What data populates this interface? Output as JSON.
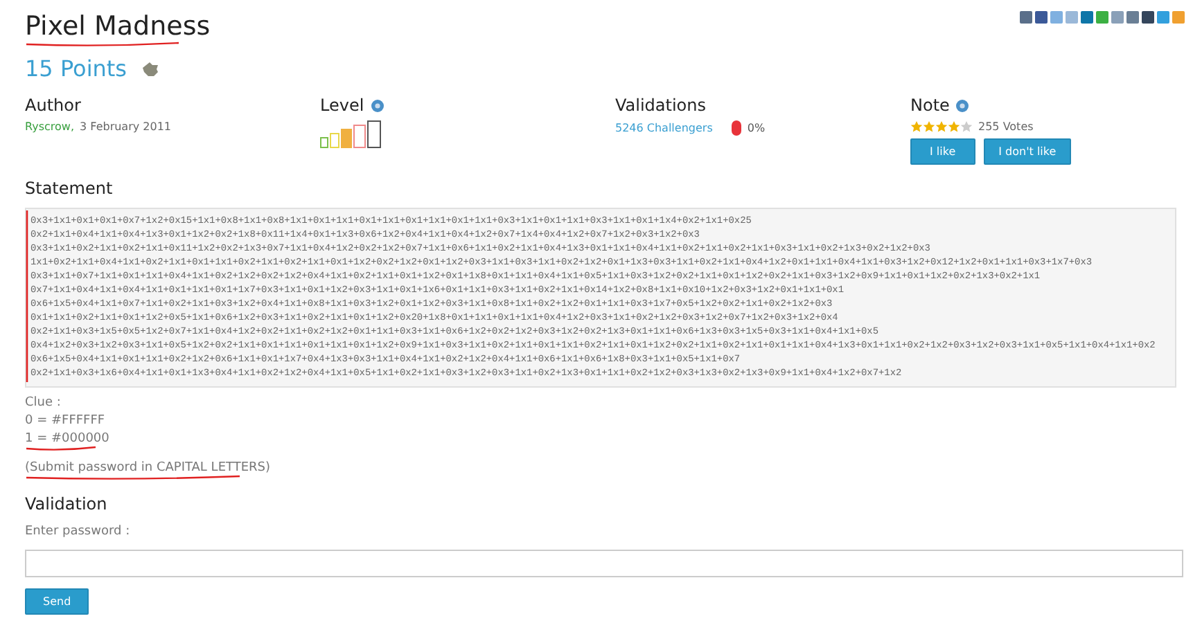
{
  "title": "Pixel Madness",
  "points": "15 Points",
  "share_icons": [
    {
      "color": "#5a6f8a"
    },
    {
      "color": "#3b5998"
    },
    {
      "color": "#7fb0e0"
    },
    {
      "color": "#9ab8d8"
    },
    {
      "color": "#0e76a8"
    },
    {
      "color": "#3cb043"
    },
    {
      "color": "#8aa0b8"
    },
    {
      "color": "#6a7f95"
    },
    {
      "color": "#35465c"
    },
    {
      "color": "#33a0dd"
    },
    {
      "color": "#f0a030"
    }
  ],
  "author": {
    "heading": "Author",
    "name": "Ryscrow,",
    "date": "3 February 2011"
  },
  "level": {
    "heading": "Level",
    "bars": [
      {
        "color": "#7cc04b",
        "selected": false
      },
      {
        "color": "#e8d84a",
        "selected": false
      },
      {
        "color": "#f0b040",
        "selected": true
      },
      {
        "color": "#f08a8a",
        "selected": false
      },
      {
        "color": "#555555",
        "selected": false
      }
    ]
  },
  "validations": {
    "heading": "Validations",
    "challengers": "5246 Challengers",
    "percent": "0%"
  },
  "note": {
    "heading": "Note",
    "stars": 4,
    "votes": "255 Votes",
    "buttons": [
      "I like",
      "I don't like"
    ]
  },
  "statement": {
    "heading": "Statement",
    "lines": [
      "0x3+1x1+0x1+0x1+0x7+1x2+0x15+1x1+0x8+1x1+0x8+1x1+0x1+1x1+0x1+1x1+0x1+1x1+0x1+1x1+0x3+1x1+0x1+1x1+0x3+1x1+0x1+1x4+0x2+1x1+0x25",
      "0x2+1x1+0x4+1x1+0x4+1x3+0x1+1x2+0x2+1x8+0x11+1x4+0x1+1x3+0x6+1x2+0x4+1x1+0x4+1x2+0x7+1x4+0x4+1x2+0x7+1x2+0x3+1x2+0x3",
      "0x3+1x1+0x2+1x1+0x2+1x1+0x11+1x2+0x2+1x3+0x7+1x1+0x4+1x2+0x2+1x2+0x7+1x1+0x6+1x1+0x2+1x1+0x4+1x3+0x1+1x1+0x4+1x1+0x2+1x1+0x2+1x1+0x3+1x1+0x2+1x3+0x2+1x2+0x3",
      "1x1+0x2+1x1+0x4+1x1+0x2+1x1+0x1+1x1+0x2+1x1+0x2+1x1+0x1+1x2+0x2+1x2+0x1+1x2+0x3+1x1+0x3+1x1+0x2+1x2+0x1+1x3+0x3+1x1+0x2+1x1+0x4+1x2+0x1+1x1+0x4+1x1+0x3+1x2+0x12+1x2+0x1+1x1+0x3+1x7+0x3",
      "0x3+1x1+0x7+1x1+0x1+1x1+0x4+1x1+0x2+1x2+0x2+1x2+0x4+1x1+0x2+1x1+0x1+1x2+0x1+1x8+0x1+1x1+0x4+1x1+0x5+1x1+0x3+1x2+0x2+1x1+0x1+1x2+0x2+1x1+0x3+1x2+0x9+1x1+0x1+1x2+0x2+1x3+0x2+1x1",
      "0x7+1x1+0x4+1x1+0x4+1x1+0x1+1x1+0x1+1x7+0x3+1x1+0x1+1x2+0x3+1x1+0x1+1x6+0x1+1x1+0x3+1x1+0x2+1x1+0x14+1x2+0x8+1x1+0x10+1x2+0x3+1x2+0x1+1x1+0x1",
      "0x6+1x5+0x4+1x1+0x7+1x1+0x2+1x1+0x3+1x2+0x4+1x1+0x8+1x1+0x3+1x2+0x1+1x2+0x3+1x1+0x8+1x1+0x2+1x2+0x1+1x1+0x3+1x7+0x5+1x2+0x2+1x1+0x2+1x2+0x3",
      "0x1+1x1+0x2+1x1+0x1+1x2+0x5+1x1+0x6+1x2+0x3+1x1+0x2+1x1+0x1+1x2+0x20+1x8+0x1+1x1+0x1+1x1+0x4+1x2+0x3+1x1+0x2+1x2+0x3+1x2+0x7+1x2+0x3+1x2+0x4",
      "0x2+1x1+0x3+1x5+0x5+1x2+0x7+1x1+0x4+1x2+0x2+1x1+0x2+1x2+0x1+1x1+0x3+1x1+0x6+1x2+0x2+1x2+0x3+1x2+0x2+1x3+0x1+1x1+0x6+1x3+0x3+1x5+0x3+1x1+0x4+1x1+0x5",
      "0x4+1x2+0x3+1x2+0x3+1x1+0x5+1x2+0x2+1x1+0x1+1x1+0x1+1x1+0x1+1x2+0x9+1x1+0x3+1x1+0x2+1x1+0x1+1x1+0x2+1x1+0x1+1x2+0x2+1x1+0x2+1x1+0x1+1x1+0x4+1x3+0x1+1x1+0x2+1x2+0x3+1x2+0x3+1x1+0x5+1x1+0x4+1x1+0x2",
      "0x6+1x5+0x4+1x1+0x1+1x1+0x2+1x2+0x6+1x1+0x1+1x7+0x4+1x3+0x3+1x1+0x4+1x1+0x2+1x2+0x4+1x1+0x6+1x1+0x6+1x8+0x3+1x1+0x5+1x1+0x7",
      "0x2+1x1+0x3+1x6+0x4+1x1+0x1+1x3+0x4+1x1+0x2+1x2+0x4+1x1+0x5+1x1+0x2+1x1+0x3+1x2+0x3+1x1+0x2+1x3+0x1+1x1+0x2+1x2+0x3+1x3+0x2+1x3+0x9+1x1+0x4+1x2+0x7+1x2"
    ]
  },
  "clue": {
    "heading": "Clue :",
    "lines": [
      "0 = #FFFFFF",
      "1 = #000000"
    ]
  },
  "hint": "(Submit password in CAPITAL LETTERS)",
  "validation": {
    "heading": "Validation",
    "label": "Enter password :",
    "button": "Send"
  }
}
